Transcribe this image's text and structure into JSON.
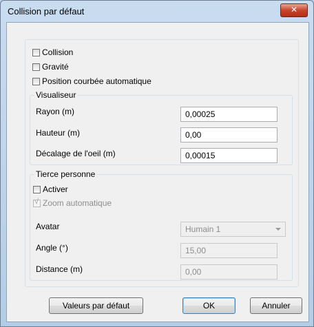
{
  "window": {
    "title": "Collision par défaut",
    "close_glyph": "✕"
  },
  "options": {
    "collision": {
      "label": "Collision",
      "checked": false
    },
    "gravity": {
      "label": "Gravité",
      "checked": false
    },
    "auto_crouch": {
      "label": "Position courbée automatique",
      "checked": false
    }
  },
  "viewer": {
    "title": "Visualiseur",
    "radius_label": "Rayon (m)",
    "radius_value": "0,00025",
    "height_label": "Hauteur (m)",
    "height_value": "0,00",
    "eye_offset_label": "Décalage de l'oeil (m)",
    "eye_offset_value": "0,00015"
  },
  "third_person": {
    "title": "Tierce personne",
    "enable_label": "Activer",
    "enable_checked": false,
    "auto_zoom_label": "Zoom automatique",
    "auto_zoom_checked": true,
    "avatar_label": "Avatar",
    "avatar_value": "Humain 1",
    "angle_label": "Angle (°)",
    "angle_value": "15,00",
    "distance_label": "Distance (m)",
    "distance_value": "0,00"
  },
  "buttons": {
    "defaults": "Valeurs par défaut",
    "ok": "OK",
    "cancel": "Annuler"
  },
  "icons": {
    "checkmark": "√"
  }
}
